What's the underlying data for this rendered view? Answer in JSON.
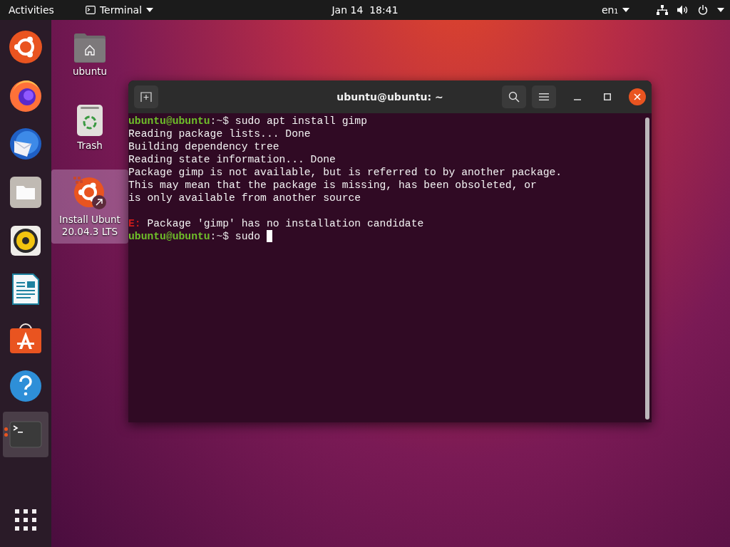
{
  "top_bar": {
    "activities": "Activities",
    "app_menu": "Terminal",
    "clock": "Jan 14  18:41",
    "input_source": "en₁"
  },
  "dock": {
    "items": [
      {
        "kind": "ubuntu",
        "selected": false,
        "running": false
      },
      {
        "kind": "firefox",
        "selected": false,
        "running": false
      },
      {
        "kind": "mail",
        "selected": false,
        "running": false
      },
      {
        "kind": "files",
        "selected": false,
        "running": false
      },
      {
        "kind": "speaker",
        "selected": false,
        "running": false
      },
      {
        "kind": "document",
        "selected": false,
        "running": false
      },
      {
        "kind": "store",
        "selected": false,
        "running": false
      },
      {
        "kind": "help",
        "selected": false,
        "running": false
      },
      {
        "kind": "terminal",
        "selected": true,
        "running": true
      }
    ]
  },
  "desktop_icons": [
    {
      "kind": "home-folder",
      "label_lines": [
        "ubuntu"
      ],
      "selected": false
    },
    {
      "kind": "trash",
      "label_lines": [
        "Trash"
      ],
      "selected": false
    },
    {
      "kind": "installer",
      "label_lines": [
        "Install Ubunt",
        "20.04.3 LTS"
      ],
      "selected": true
    }
  ],
  "terminal": {
    "title": "ubuntu@ubuntu: ~",
    "lines": [
      {
        "kind": "prompt",
        "user": "ubuntu@ubuntu",
        "rest": ":~$",
        "command": "sudo apt install gimp",
        "cursor": false
      },
      {
        "kind": "output",
        "text": "Reading package lists... Done"
      },
      {
        "kind": "output",
        "text": "Building dependency tree"
      },
      {
        "kind": "output",
        "text": "Reading state information... Done"
      },
      {
        "kind": "output",
        "text": "Package gimp is not available, but is referred to by another package."
      },
      {
        "kind": "output",
        "text": "This may mean that the package is missing, has been obsoleted, or"
      },
      {
        "kind": "output",
        "text": "is only available from another source"
      },
      {
        "kind": "blank"
      },
      {
        "kind": "error",
        "tag": "E:",
        "text": "Package 'gimp' has no installation candidate"
      },
      {
        "kind": "prompt",
        "user": "ubuntu@ubuntu",
        "rest": ":~$",
        "command": "sudo",
        "cursor": true
      }
    ]
  }
}
